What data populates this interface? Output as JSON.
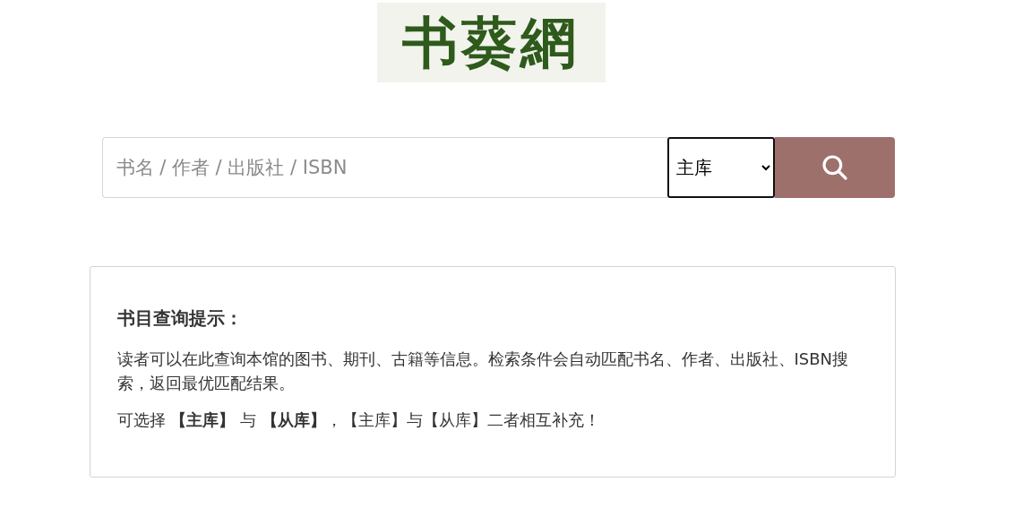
{
  "logo": {
    "text": "书葵網"
  },
  "search": {
    "placeholder": "书名 / 作者 / 出版社 / ISBN",
    "library": "主库"
  },
  "tips": {
    "title": "书目查询提示：",
    "paragraphs": [
      "读者可以在此查询本馆的图书、期刊、古籍等信息。检索条件会自动匹配书名、作者、出版社、ISBN搜索，返回最优匹配结果。",
      "可选择 **【主库】** 与 **【从库】**，【主库】与【从库】二者相互补充！"
    ]
  }
}
